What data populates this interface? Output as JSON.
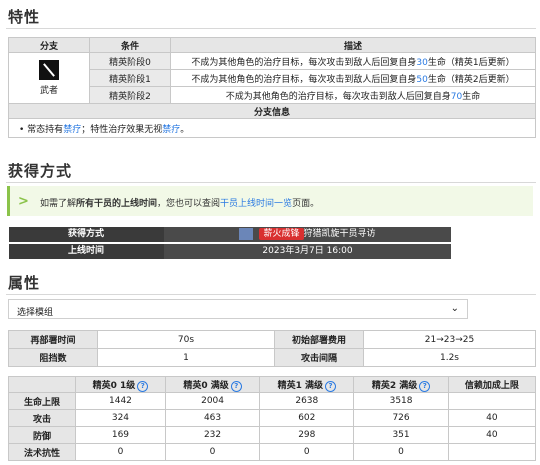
{
  "traits": {
    "title": "特性",
    "headers": {
      "branch": "分支",
      "condition": "条件",
      "description": "描述"
    },
    "branch_name": "武者",
    "rows": [
      {
        "cond": "精英阶段0",
        "d1": "不成为其他角色的治疗目标，每次攻击到敌人后回复自身",
        "num": "30",
        "d2": "生命（精英1后更新）"
      },
      {
        "cond": "精英阶段1",
        "d1": "不成为其他角色的治疗目标，每次攻击到敌人后回复自身",
        "num": "50",
        "d2": "生命（精英2后更新）"
      },
      {
        "cond": "精英阶段2",
        "d1": "不成为其他角色的治疗目标，每次攻击到敌人后回复自身",
        "num": "70",
        "d2": "生命"
      }
    ],
    "info_header": "分支信息",
    "info": {
      "p1": "常态持有",
      "l1": "禁疗",
      "p2": "；特性治疗效果无视",
      "l2": "禁疗",
      "p3": "。"
    }
  },
  "obtain": {
    "title": "获得方式",
    "tip": {
      "p1": "如需了解",
      "bold": "所有干员的上线时间",
      "p2": "，您也可以查阅",
      "link": "干员上线时间一览",
      "p3": "页面。"
    },
    "method_label": "获得方式",
    "method_badge": "薪火成锋",
    "method_text": "狩猎凯旋干员寻访",
    "time_label": "上线时间",
    "time_value": "2023年3月7日 16:00"
  },
  "attrs": {
    "title": "属性",
    "select_placeholder": "选择模组",
    "deploy": [
      {
        "k1": "再部署时间",
        "v1": "70s",
        "k2": "初始部署费用",
        "v2": "21→23→25"
      },
      {
        "k1": "阻挡数",
        "v1": "1",
        "k2": "攻击间隔",
        "v2": "1.2s"
      }
    ],
    "stats_headers": [
      "",
      "精英0 1级",
      "精英0 满级",
      "精英1 满级",
      "精英2 满级",
      "信赖加成上限"
    ],
    "stats_rows": [
      {
        "name": "生命上限",
        "v": [
          "1442",
          "2004",
          "2638",
          "3518",
          ""
        ]
      },
      {
        "name": "攻击",
        "v": [
          "324",
          "463",
          "602",
          "726",
          "40"
        ]
      },
      {
        "name": "防御",
        "v": [
          "169",
          "232",
          "298",
          "351",
          "40"
        ]
      },
      {
        "name": "法术抗性",
        "v": [
          "0",
          "0",
          "0",
          "0",
          ""
        ]
      }
    ]
  }
}
